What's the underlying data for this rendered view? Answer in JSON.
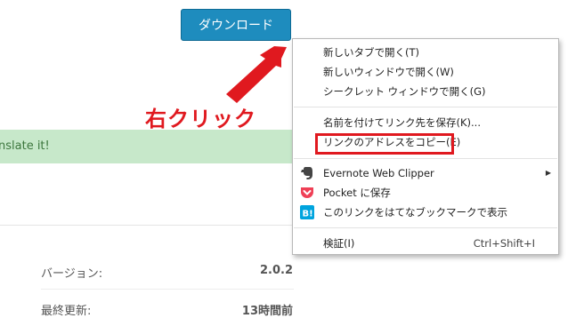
{
  "page": {
    "download_button": "ダウンロード",
    "annotation": "右クリック",
    "translate_text": "nslate it!",
    "version_label": "バージョン:",
    "version_value": "2.0.2",
    "updated_label": "最終更新:",
    "updated_value": "13時間前"
  },
  "context_menu": {
    "items": [
      {
        "label": "新しいタブで開く(T)"
      },
      {
        "label": "新しいウィンドウで開く(W)"
      },
      {
        "label": "シークレット ウィンドウで開く(G)"
      },
      {
        "label": "名前を付けてリンク先を保存(K)..."
      },
      {
        "label": "リンクのアドレスをコピー(E)"
      },
      {
        "label": "Evernote Web Clipper"
      },
      {
        "label": "Pocket に保存"
      },
      {
        "label": "このリンクをはてなブックマークで表示"
      },
      {
        "label": "検証(I)",
        "shortcut": "Ctrl+Shift+I"
      }
    ],
    "icons": {
      "evernote": "elephant-icon",
      "pocket": "pocket-icon",
      "hatena": "hatena-bookmark-icon"
    }
  },
  "colors": {
    "accent_red": "#e0191f",
    "button_blue": "#1e8cbe",
    "translate_bg": "#c7e8ca",
    "pocket_red": "#ef4056",
    "hatena_blue": "#00a4de"
  }
}
